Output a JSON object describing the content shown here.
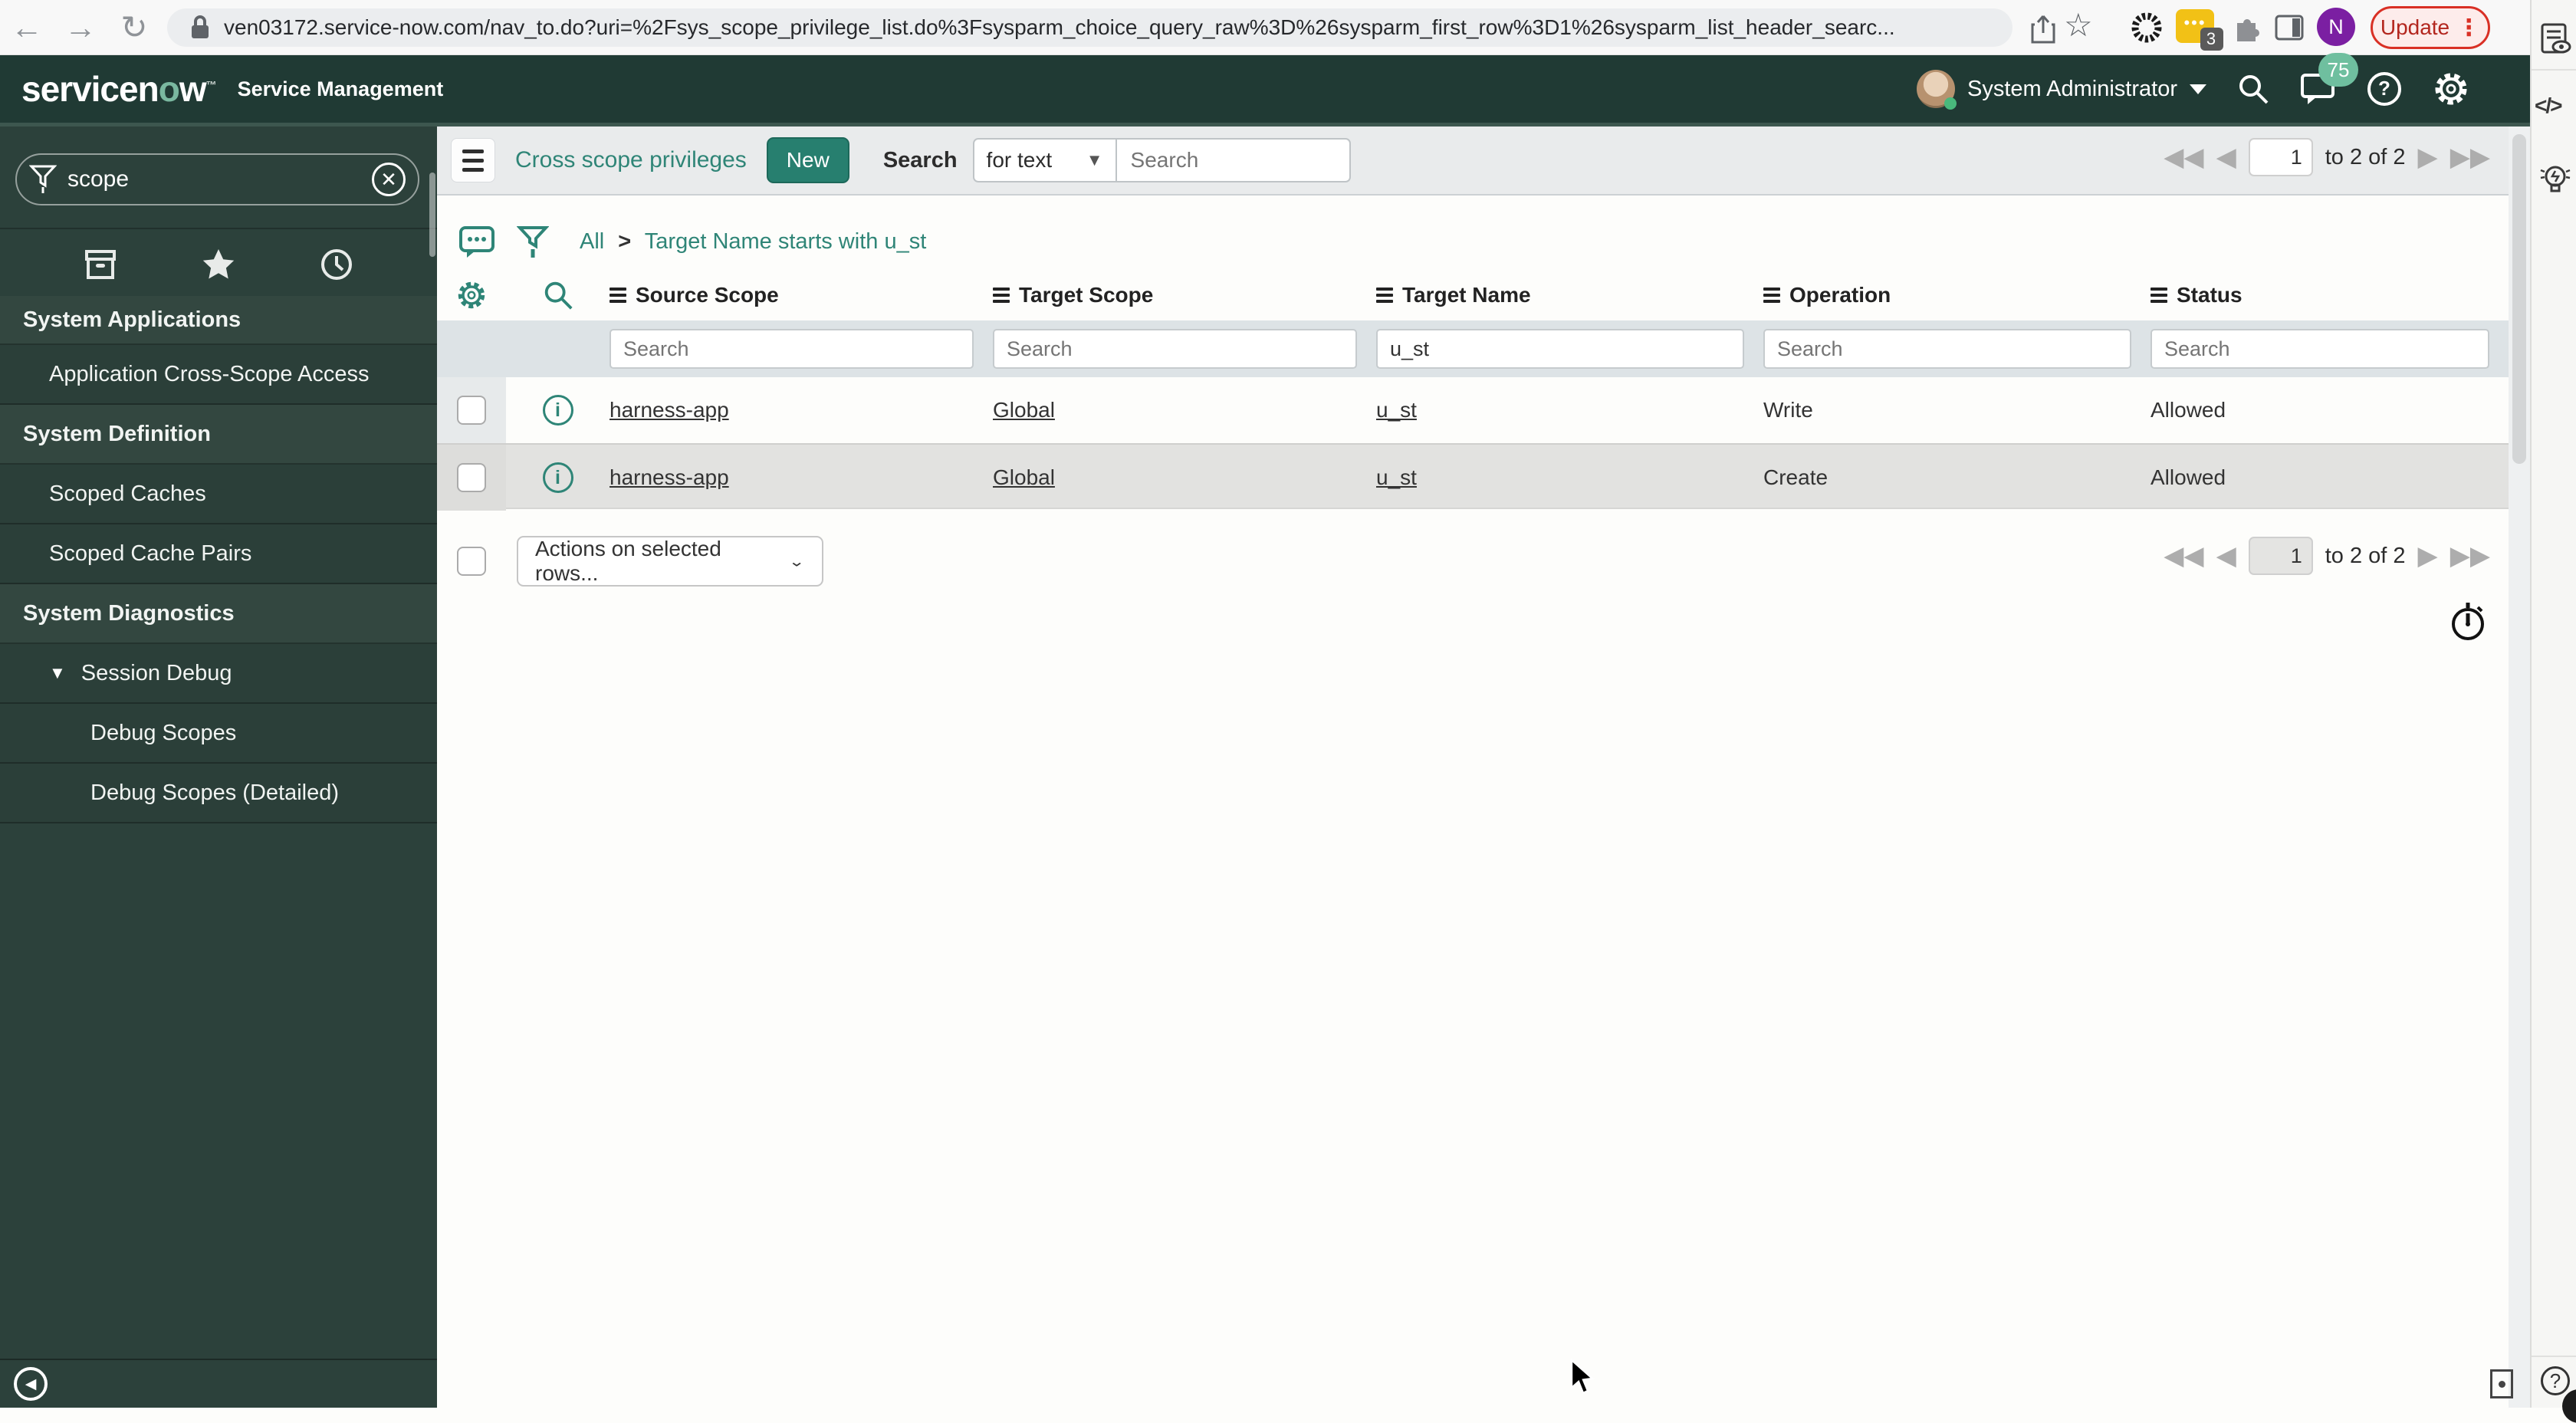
{
  "browser": {
    "url": "ven03172.service-now.com/nav_to.do?uri=%2Fsys_scope_privilege_list.do%3Fsysparm_choice_query_raw%3D%26sysparm_first_row%3D1%26sysparm_list_header_searc...",
    "update_label": "Update",
    "kebab": "⋮",
    "profile_initial": "N",
    "extension_badge": "3",
    "extension_dots": "•••",
    "back": "←",
    "forward": "→",
    "reload": "↻",
    "star": "☆"
  },
  "banner": {
    "logo_pre": "servicen",
    "logo_o": "o",
    "logo_post": "w",
    "logo_tm": "™",
    "product": "Service Management",
    "user": "System Administrator",
    "notification_count": "75"
  },
  "sidebar": {
    "search_value": "scope",
    "clear_glyph": "✕",
    "collapse_glyph": "◀",
    "items": [
      {
        "label": "System Applications"
      },
      {
        "label": "Application Cross-Scope Access"
      },
      {
        "label": "System Definition"
      },
      {
        "label": "Scoped Caches"
      },
      {
        "label": "Scoped Cache Pairs"
      },
      {
        "label": "System Diagnostics"
      },
      {
        "label": "Session Debug",
        "caret": "▼"
      },
      {
        "label": "Debug Scopes"
      },
      {
        "label": "Debug Scopes (Detailed)"
      }
    ]
  },
  "toolbar": {
    "list_title": "Cross scope privileges",
    "new_label": "New",
    "search_label": "Search",
    "search_mode": "for text",
    "mode_caret": "▼",
    "search_placeholder": "Search"
  },
  "pagination": {
    "page": "1",
    "range_label": "to 2 of 2",
    "first": "◀",
    "prev": "◀",
    "next": "▶",
    "last": "▶"
  },
  "breadcrumb": {
    "root": "All",
    "separator": ">",
    "filter": "Target Name starts with u_st"
  },
  "table": {
    "columns": [
      "Source Scope",
      "Target Scope",
      "Target Name",
      "Operation",
      "Status"
    ],
    "filter_placeholder": "Search",
    "filter_value_target_name": "u_st",
    "info_glyph": "i",
    "rows": [
      {
        "source_scope": "harness-app",
        "target_scope": "Global",
        "target_name": "u_st",
        "operation": "Write",
        "status": "Allowed"
      },
      {
        "source_scope": "harness-app",
        "target_scope": "Global",
        "target_name": "u_st",
        "operation": "Create",
        "status": "Allowed"
      }
    ]
  },
  "actions": {
    "label": "Actions on selected rows...",
    "chevron": "⌄"
  },
  "right_panel": {
    "code_glyph": "</>",
    "help_glyph": "?"
  },
  "colors": {
    "accent_teal": "#277f6f",
    "banner_green": "#203a34",
    "update_red": "#c5221f",
    "badge_green": "#6fbf9f"
  }
}
